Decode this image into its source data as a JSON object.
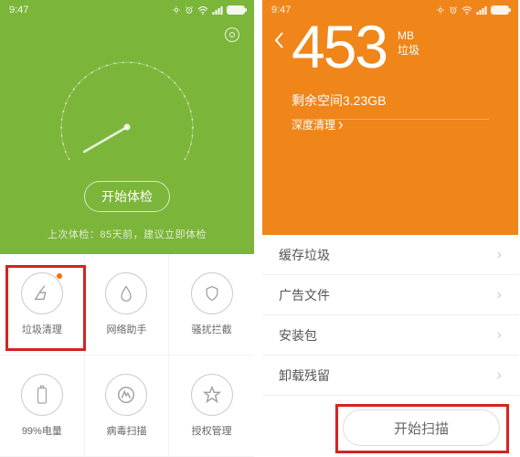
{
  "statusbar": {
    "time": "9:47"
  },
  "left": {
    "start_label": "开始体检",
    "last_check": "上次体检：85天前，建议立即体检",
    "tiles": [
      {
        "label": "垃圾清理"
      },
      {
        "label": "网络助手"
      },
      {
        "label": "骚扰拦截"
      },
      {
        "label": "99%电量"
      },
      {
        "label": "病毒扫描"
      },
      {
        "label": "授权管理"
      }
    ]
  },
  "right": {
    "value": "453",
    "unit": "MB",
    "unit_sub": "垃圾",
    "space_label": "剩余空间",
    "space_value": "3.23GB",
    "deep_label": "深度清理",
    "rows": [
      {
        "label": "缓存垃圾"
      },
      {
        "label": "广告文件"
      },
      {
        "label": "安装包"
      },
      {
        "label": "卸载残留"
      }
    ],
    "scan_label": "开始扫描"
  },
  "chart_data": {
    "type": "gauge",
    "title": "",
    "range": [
      0,
      100
    ],
    "value": 0,
    "note": "Semi-circular dial with tick marks; needle resting near left/minimum"
  }
}
